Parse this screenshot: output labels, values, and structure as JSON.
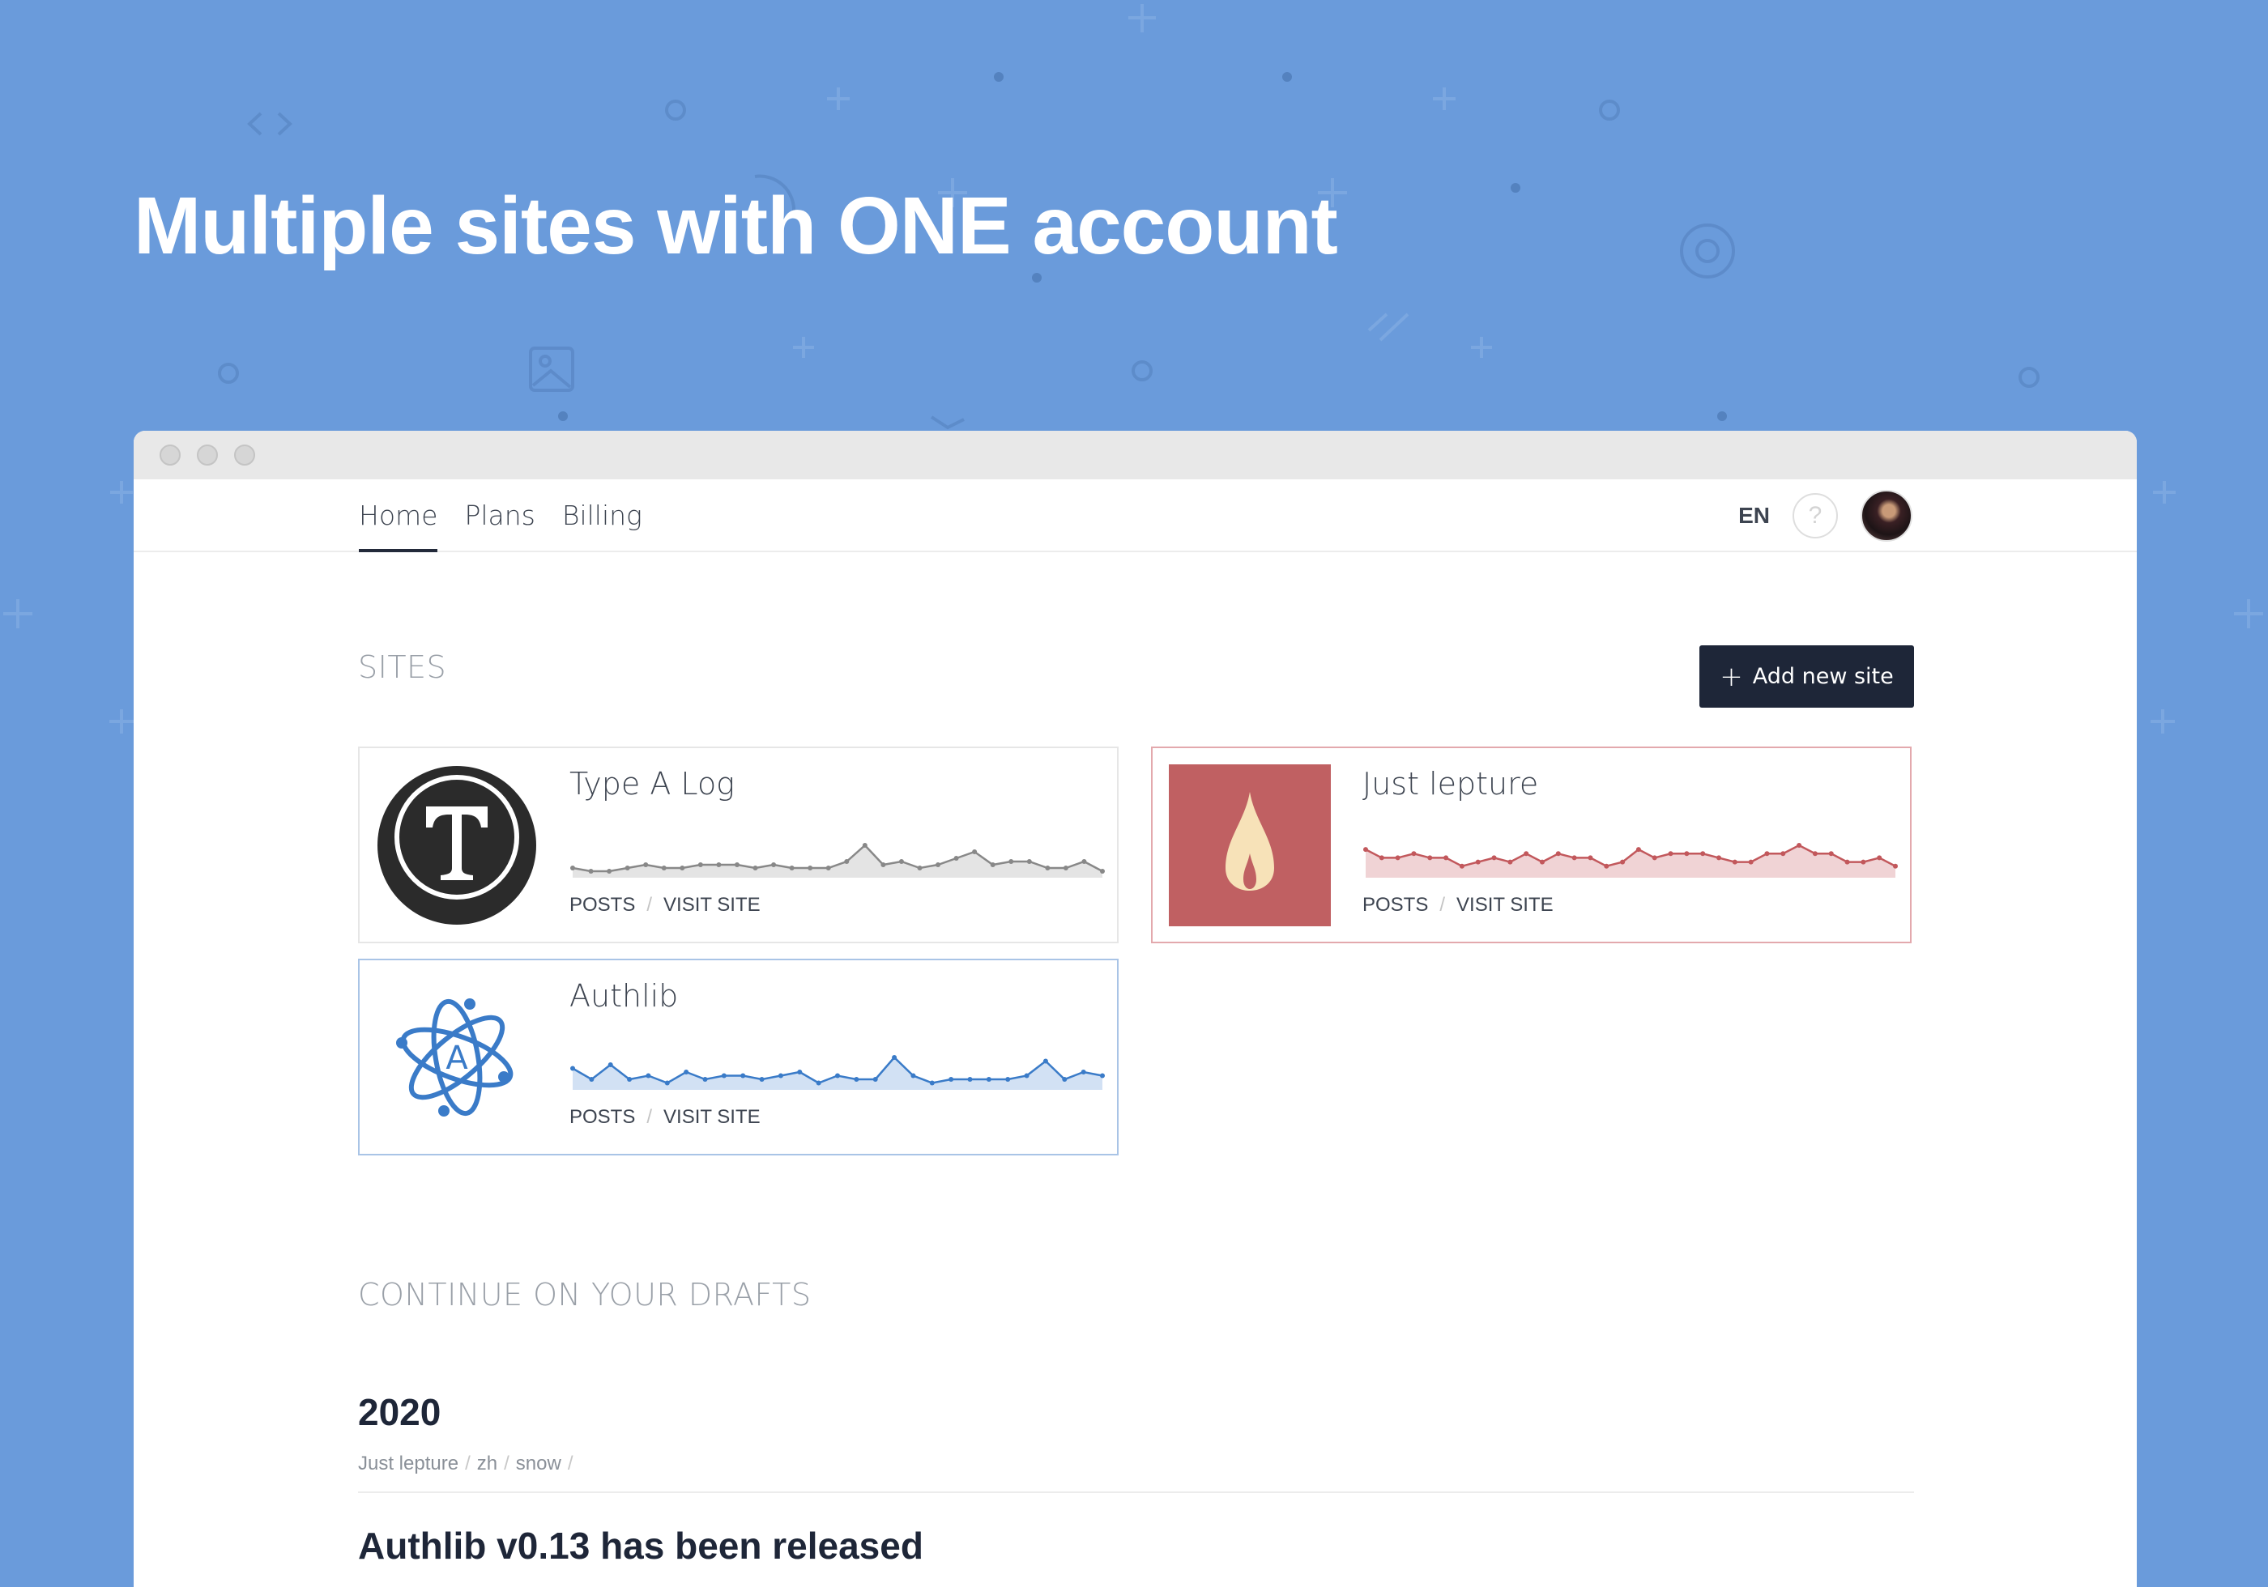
{
  "hero": {
    "title": "Multiple sites with ONE account"
  },
  "nav": {
    "links": [
      {
        "label": "Home",
        "active": true
      },
      {
        "label": "Plans",
        "active": false
      },
      {
        "label": "Billing",
        "active": false
      }
    ],
    "language": "EN",
    "help_icon": "question-circle-icon",
    "avatar_icon": "user-avatar"
  },
  "sites": {
    "title": "SITES",
    "add_button": {
      "icon": "plus-icon",
      "label": "Add new site"
    },
    "items": [
      {
        "name": "Type A Log",
        "logo_icon": "typewriter-t-icon",
        "accent": "#888888",
        "fill": "#e4e4e4",
        "posts_label": "POSTS",
        "visit_label": "VISIT SITE",
        "trend": [
          2,
          1,
          1,
          2,
          3,
          2,
          2,
          3,
          3,
          3,
          2,
          3,
          2,
          2,
          2,
          4,
          9,
          3,
          4,
          2,
          3,
          5,
          7,
          3,
          4,
          4,
          2,
          2,
          4,
          1
        ]
      },
      {
        "name": "Just lepture",
        "logo_icon": "flame-icon",
        "accent": "#c2585c",
        "fill": "#f0d3d5",
        "posts_label": "POSTS",
        "visit_label": "VISIT SITE",
        "trend": [
          6,
          4,
          4,
          5,
          4,
          4,
          2,
          3,
          4,
          3,
          5,
          3,
          5,
          4,
          4,
          2,
          3,
          6,
          4,
          5,
          5,
          5,
          4,
          3,
          3,
          5,
          5,
          7,
          5,
          5,
          3,
          3,
          4,
          2
        ]
      },
      {
        "name": "Authlib",
        "logo_icon": "atom-a-icon",
        "accent": "#3a7bc8",
        "fill": "#d2e1f4",
        "posts_label": "POSTS",
        "visit_label": "VISIT SITE",
        "trend": [
          5,
          2,
          6,
          2,
          3,
          1,
          4,
          2,
          3,
          3,
          2,
          3,
          4,
          1,
          3,
          2,
          2,
          8,
          3,
          1,
          2,
          2,
          2,
          2,
          3,
          7,
          2,
          4,
          3
        ]
      }
    ]
  },
  "drafts": {
    "title": "CONTINUE ON YOUR DRAFTS",
    "year": "2020",
    "meta": [
      "Just lepture",
      "zh",
      "snow"
    ],
    "first_title": "Authlib v0.13 has been released"
  }
}
